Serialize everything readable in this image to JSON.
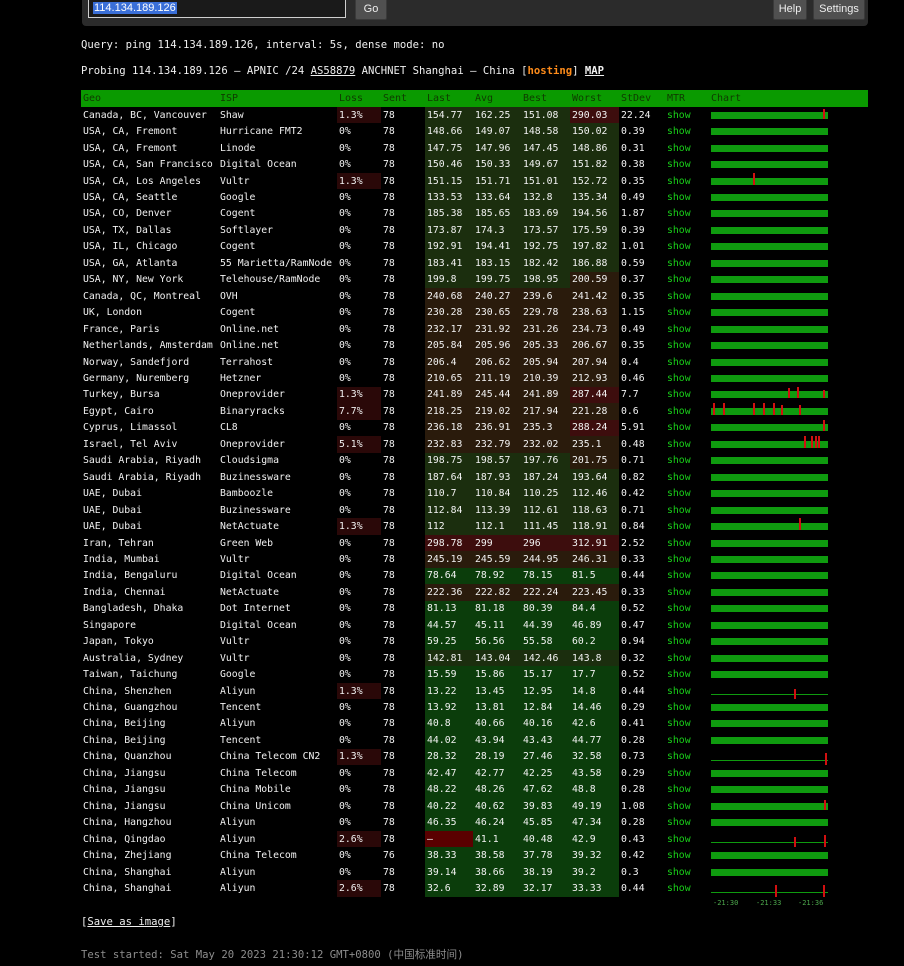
{
  "toolbar": {
    "target_value": "114.134.189.126",
    "go_label": "Go",
    "help_label": "Help",
    "settings_label": "Settings"
  },
  "query_line": "Query: ping 114.134.189.126, interval: 5s, dense mode: no",
  "probe": {
    "prefix": "Probing 114.134.189.126 — APNIC /24 ",
    "asn": "AS58879",
    "org": " ANCHNET Shanghai — China [",
    "tag": "hosting",
    "close": "] ",
    "map": "MAP"
  },
  "table": {
    "headers": [
      "Geo",
      "ISP",
      "Loss",
      "Sent",
      "Last",
      "Avg",
      "Best",
      "Worst",
      "StDev",
      "MTR",
      "Chart"
    ],
    "mtr_label": "show",
    "rows": [
      [
        "Canada, BC, Vancouver",
        "Shaw",
        "1.3%",
        "78",
        "154.77",
        "162.25",
        "151.08",
        "290.03",
        "22.24"
      ],
      [
        "USA, CA, Fremont",
        "Hurricane FMT2",
        "0%",
        "78",
        "148.66",
        "149.07",
        "148.58",
        "150.02",
        "0.39"
      ],
      [
        "USA, CA, Fremont",
        "Linode",
        "0%",
        "78",
        "147.75",
        "147.96",
        "147.45",
        "148.86",
        "0.31"
      ],
      [
        "USA, CA, San Francisco",
        "Digital Ocean",
        "0%",
        "78",
        "150.46",
        "150.33",
        "149.67",
        "151.82",
        "0.38"
      ],
      [
        "USA, CA, Los Angeles",
        "Vultr",
        "1.3%",
        "78",
        "151.15",
        "151.71",
        "151.01",
        "152.72",
        "0.35"
      ],
      [
        "USA, CA, Seattle",
        "Google",
        "0%",
        "78",
        "133.53",
        "133.64",
        "132.8",
        "135.34",
        "0.49"
      ],
      [
        "USA, CO, Denver",
        "Cogent",
        "0%",
        "78",
        "185.38",
        "185.65",
        "183.69",
        "194.56",
        "1.87"
      ],
      [
        "USA, TX, Dallas",
        "Softlayer",
        "0%",
        "78",
        "173.87",
        "174.3",
        "173.57",
        "175.59",
        "0.39"
      ],
      [
        "USA, IL, Chicago",
        "Cogent",
        "0%",
        "78",
        "192.91",
        "194.41",
        "192.75",
        "197.82",
        "1.01"
      ],
      [
        "USA, GA, Atlanta",
        "55 Marietta/RamNode",
        "0%",
        "78",
        "183.41",
        "183.15",
        "182.42",
        "186.88",
        "0.59"
      ],
      [
        "USA, NY, New York",
        "Telehouse/RamNode",
        "0%",
        "78",
        "199.8",
        "199.75",
        "198.95",
        "200.59",
        "0.37"
      ],
      [
        "Canada, QC, Montreal",
        "OVH",
        "0%",
        "78",
        "240.68",
        "240.27",
        "239.6",
        "241.42",
        "0.35"
      ],
      [
        "UK, London",
        "Cogent",
        "0%",
        "78",
        "230.28",
        "230.65",
        "229.78",
        "238.63",
        "1.15"
      ],
      [
        "France, Paris",
        "Online.net",
        "0%",
        "78",
        "232.17",
        "231.92",
        "231.26",
        "234.73",
        "0.49"
      ],
      [
        "Netherlands, Amsterdam",
        "Online.net",
        "0%",
        "78",
        "205.84",
        "205.96",
        "205.33",
        "206.67",
        "0.35"
      ],
      [
        "Norway, Sandefjord",
        "Terrahost",
        "0%",
        "78",
        "206.4",
        "206.62",
        "205.94",
        "207.94",
        "0.4"
      ],
      [
        "Germany, Nuremberg",
        "Hetzner",
        "0%",
        "78",
        "210.65",
        "211.19",
        "210.39",
        "212.93",
        "0.46"
      ],
      [
        "Turkey, Bursa",
        "Oneprovider",
        "1.3%",
        "78",
        "241.89",
        "245.44",
        "241.89",
        "287.44",
        "7.7"
      ],
      [
        "Egypt, Cairo",
        "Binaryracks",
        "7.7%",
        "78",
        "218.25",
        "219.02",
        "217.94",
        "221.28",
        "0.6"
      ],
      [
        "Cyprus, Limassol",
        "CL8",
        "0%",
        "78",
        "236.18",
        "236.91",
        "235.3",
        "288.24",
        "5.91"
      ],
      [
        "Israel, Tel Aviv",
        "Oneprovider",
        "5.1%",
        "78",
        "232.83",
        "232.79",
        "232.02",
        "235.1",
        "0.48"
      ],
      [
        "Saudi Arabia, Riyadh",
        "Cloudsigma",
        "0%",
        "78",
        "198.75",
        "198.57",
        "197.76",
        "201.75",
        "0.71"
      ],
      [
        "Saudi Arabia, Riyadh",
        "Buzinessware",
        "0%",
        "78",
        "187.64",
        "187.93",
        "187.24",
        "193.64",
        "0.82"
      ],
      [
        "UAE, Dubai",
        "Bamboozle",
        "0%",
        "78",
        "110.7",
        "110.84",
        "110.25",
        "112.46",
        "0.42"
      ],
      [
        "UAE, Dubai",
        "Buzinessware",
        "0%",
        "78",
        "112.84",
        "113.39",
        "112.61",
        "118.63",
        "0.71"
      ],
      [
        "UAE, Dubai",
        "NetActuate",
        "1.3%",
        "78",
        "112",
        "112.1",
        "111.45",
        "118.91",
        "0.84"
      ],
      [
        "Iran, Tehran",
        "Green Web",
        "0%",
        "78",
        "298.78",
        "299",
        "296",
        "312.91",
        "2.52"
      ],
      [
        "India, Mumbai",
        "Vultr",
        "0%",
        "78",
        "245.19",
        "245.59",
        "244.95",
        "246.31",
        "0.33"
      ],
      [
        "India, Bengaluru",
        "Digital Ocean",
        "0%",
        "78",
        "78.64",
        "78.92",
        "78.15",
        "81.5",
        "0.44"
      ],
      [
        "India, Chennai",
        "NetActuate",
        "0%",
        "78",
        "222.36",
        "222.82",
        "222.24",
        "223.45",
        "0.33"
      ],
      [
        "Bangladesh, Dhaka",
        "Dot Internet",
        "0%",
        "78",
        "81.13",
        "81.18",
        "80.39",
        "84.4",
        "0.52"
      ],
      [
        "Singapore",
        "Digital Ocean",
        "0%",
        "78",
        "44.57",
        "45.11",
        "44.39",
        "46.89",
        "0.47"
      ],
      [
        "Japan, Tokyo",
        "Vultr",
        "0%",
        "78",
        "59.25",
        "56.56",
        "55.58",
        "60.2",
        "0.94"
      ],
      [
        "Australia, Sydney",
        "Vultr",
        "0%",
        "78",
        "142.81",
        "143.04",
        "142.46",
        "143.8",
        "0.32"
      ],
      [
        "Taiwan, Taichung",
        "Google",
        "0%",
        "78",
        "15.59",
        "15.86",
        "15.17",
        "17.7",
        "0.52"
      ],
      [
        "China, Shenzhen",
        "Aliyun",
        "1.3%",
        "78",
        "13.22",
        "13.45",
        "12.95",
        "14.8",
        "0.44"
      ],
      [
        "China, Guangzhou",
        "Tencent",
        "0%",
        "78",
        "13.92",
        "13.81",
        "12.84",
        "14.46",
        "0.29"
      ],
      [
        "China, Beijing",
        "Aliyun",
        "0%",
        "78",
        "40.8",
        "40.66",
        "40.16",
        "42.6",
        "0.41"
      ],
      [
        "China, Beijing",
        "Tencent",
        "0%",
        "78",
        "44.02",
        "43.94",
        "43.43",
        "44.77",
        "0.28"
      ],
      [
        "China, Quanzhou",
        "China Telecom CN2",
        "1.3%",
        "78",
        "28.32",
        "28.19",
        "27.46",
        "32.58",
        "0.73"
      ],
      [
        "China, Jiangsu",
        "China Telecom",
        "0%",
        "78",
        "42.47",
        "42.77",
        "42.25",
        "43.58",
        "0.29"
      ],
      [
        "China, Jiangsu",
        "China Mobile",
        "0%",
        "78",
        "48.22",
        "48.26",
        "47.62",
        "48.8",
        "0.28"
      ],
      [
        "China, Jiangsu",
        "China Unicom",
        "0%",
        "78",
        "40.22",
        "40.62",
        "39.83",
        "49.19",
        "1.08"
      ],
      [
        "China, Hangzhou",
        "Aliyun",
        "0%",
        "78",
        "46.35",
        "46.24",
        "45.85",
        "47.34",
        "0.28"
      ],
      [
        "China, Qingdao",
        "Aliyun",
        "2.6%",
        "78",
        "–",
        "41.1",
        "40.48",
        "42.9",
        "0.43"
      ],
      [
        "China, Zhejiang",
        "China Telecom",
        "0%",
        "76",
        "38.33",
        "38.58",
        "37.78",
        "39.32",
        "0.42"
      ],
      [
        "China, Shanghai",
        "Aliyun",
        "0%",
        "78",
        "39.14",
        "38.66",
        "38.19",
        "39.2",
        "0.3"
      ],
      [
        "China, Shanghai",
        "Aliyun",
        "2.6%",
        "78",
        "32.6",
        "32.89",
        "32.17",
        "33.33",
        "0.44"
      ]
    ],
    "chart_time_labels": [
      "-21:30",
      "-21:33",
      "-21:36"
    ]
  },
  "footer": {
    "save_label": "Save as image",
    "test_started": "Test started: Sat May 20 2023 21:30:12 GMT+0800 (中国标准时间)"
  },
  "colors": {
    "header_green": "#0a9a00",
    "latency_low": "#0d3a0d",
    "latency_high": "#3d0d0d",
    "loss_bg": "#2a0808",
    "mtr_link": "#19d119",
    "hosting_orange": "#ff8c1a"
  }
}
